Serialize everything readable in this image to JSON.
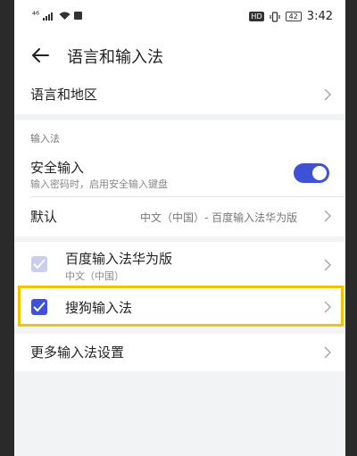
{
  "statusbar": {
    "signal_label": "⁴⁶",
    "hd_label": "HD",
    "battery_level": "42",
    "time": "3:42"
  },
  "appbar": {
    "title": "语言和输入法"
  },
  "language_region": {
    "label": "语言和地区"
  },
  "input_section": {
    "label": "输入法"
  },
  "secure_input": {
    "label": "安全输入",
    "description": "输入密码时，启用安全输入键盘",
    "enabled": true
  },
  "default_ime": {
    "label": "默认",
    "value": "中文（中国）- 百度输入法华为版"
  },
  "ime_list": [
    {
      "label": "百度输入法华为版",
      "sublabel": "中文（中国）",
      "checked": true,
      "disabled": true
    },
    {
      "label": "搜狗输入法",
      "checked": true,
      "disabled": false
    }
  ],
  "more_settings": {
    "label": "更多输入法设置"
  },
  "colors": {
    "accent": "#3f51d6",
    "highlight": "#f0c400"
  }
}
